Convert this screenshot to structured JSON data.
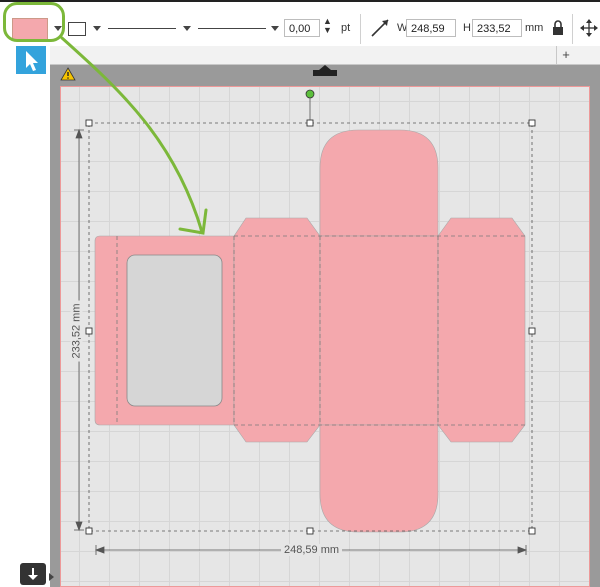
{
  "toolbar": {
    "line_width_value": "0,00",
    "line_width_unit": "pt",
    "width_label": "W",
    "width_value": "248,59",
    "height_label": "H",
    "height_value": "233,52",
    "size_unit": "mm"
  },
  "canvas": {
    "width_dimension": "248,59 mm",
    "height_dimension": "233,52 mm"
  },
  "colors": {
    "fill": "#f4a8ad",
    "highlight": "#7cb83a",
    "tool_accent": "#33a3dc"
  }
}
